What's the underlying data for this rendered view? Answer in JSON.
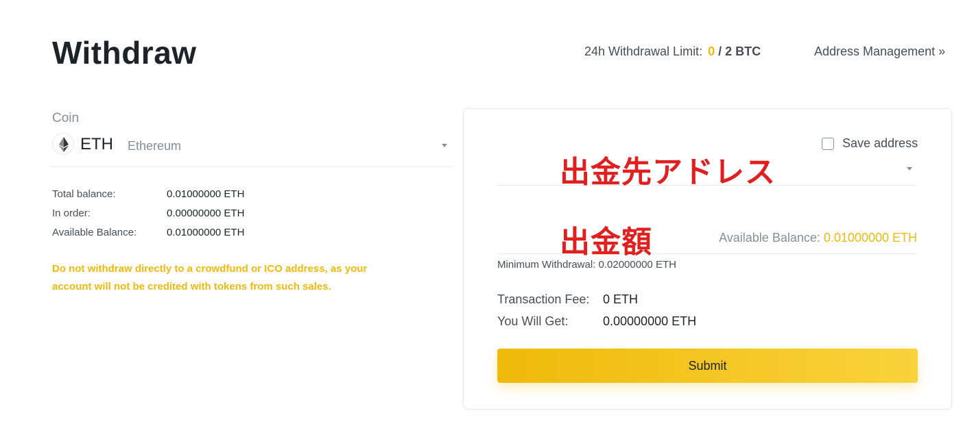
{
  "header": {
    "title": "Withdraw",
    "limit_label": "24h Withdrawal Limit:",
    "limit_used": "0",
    "limit_total": "/ 2 BTC",
    "address_management": "Address Management »"
  },
  "coin": {
    "label": "Coin",
    "symbol": "ETH",
    "name": "Ethereum",
    "icon": "ethereum-icon"
  },
  "balances": [
    {
      "label": "Total balance:",
      "value": "0.01000000 ETH"
    },
    {
      "label": "In order:",
      "value": "0.00000000 ETH"
    },
    {
      "label": "Available Balance:",
      "value": "0.01000000 ETH"
    }
  ],
  "warning": "Do not withdraw directly to a crowdfund or ICO address, as your account will not be credited with tokens from such sales.",
  "form": {
    "save_address": "Save address",
    "address_annotation": "出金先アドレス",
    "amount_annotation": "出金額",
    "available_label": "Available Balance:",
    "available_value": "0.01000000 ETH",
    "min_withdrawal": "Minimum Withdrawal: 0.02000000 ETH",
    "fee_label": "Transaction Fee:",
    "fee_value": "0 ETH",
    "get_label": "You Will Get:",
    "get_value": "0.00000000 ETH",
    "submit": "Submit"
  },
  "colors": {
    "accent": "#f0b90b",
    "annotation": "#e0201f",
    "text": "#1e2329",
    "muted": "#848e9c"
  }
}
